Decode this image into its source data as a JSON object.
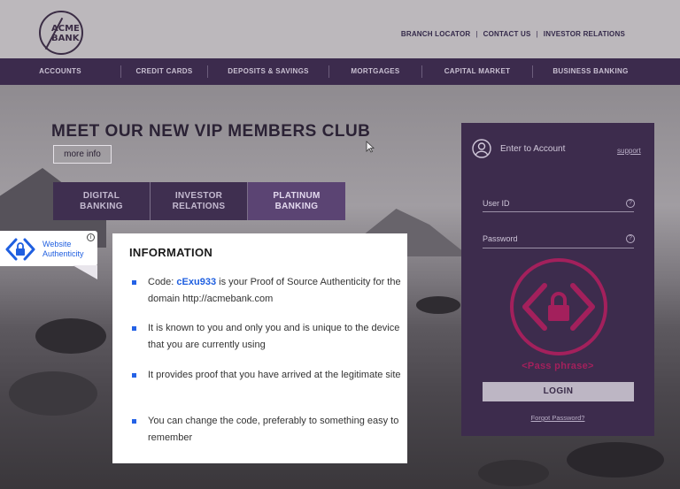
{
  "header": {
    "logo_text": "ACME\nBANK",
    "links": [
      "BRANCH LOCATOR",
      "CONTACT US",
      "INVESTOR RELATIONS"
    ]
  },
  "nav": {
    "items": [
      "ACCOUNTS",
      "CREDIT CARDS",
      "DEPOSITS & SAVINGS",
      "MORTGAGES",
      "CAPITAL MARKET",
      "BUSINESS BANKING"
    ]
  },
  "hero": {
    "headline": "MEET OUR NEW VIP MEMBERS CLUB",
    "more_button": "more info",
    "tabs": [
      {
        "line1": "DIGITAL",
        "line2": "BANKING"
      },
      {
        "line1": "INVESTOR",
        "line2": "RELATIONS"
      },
      {
        "line1": "PLATINUM",
        "line2": "BANKING"
      }
    ]
  },
  "badge": {
    "line1": "Website",
    "line2": "Authenticity",
    "info_icon": "i",
    "icon": "lock-shield-icon"
  },
  "info": {
    "title": "INFORMATION",
    "item1_prefix": "Code: ",
    "code": "cExu933",
    "item1_suffix": " is your Proof of Source Authenticity for the domain http://acmebank.com",
    "item2": "It is known to you and only you and is unique to the device that you are currently using",
    "item3": "It provides proof that you have arrived at the legitimate site",
    "item4": "You can change the code, preferably to something easy to remember"
  },
  "login": {
    "title": "Enter to Account",
    "support": "support",
    "user_id_label": "User ID",
    "password_label": "Password",
    "help_icon": "?",
    "passphrase": "<Pass phrase>",
    "login_button": "LOGIN",
    "forgot": "Forgot Password?"
  },
  "colors": {
    "nav_bg": "#3c2b4d",
    "accent_blue": "#1f5fe0",
    "passphrase_magenta": "#a3205c"
  }
}
